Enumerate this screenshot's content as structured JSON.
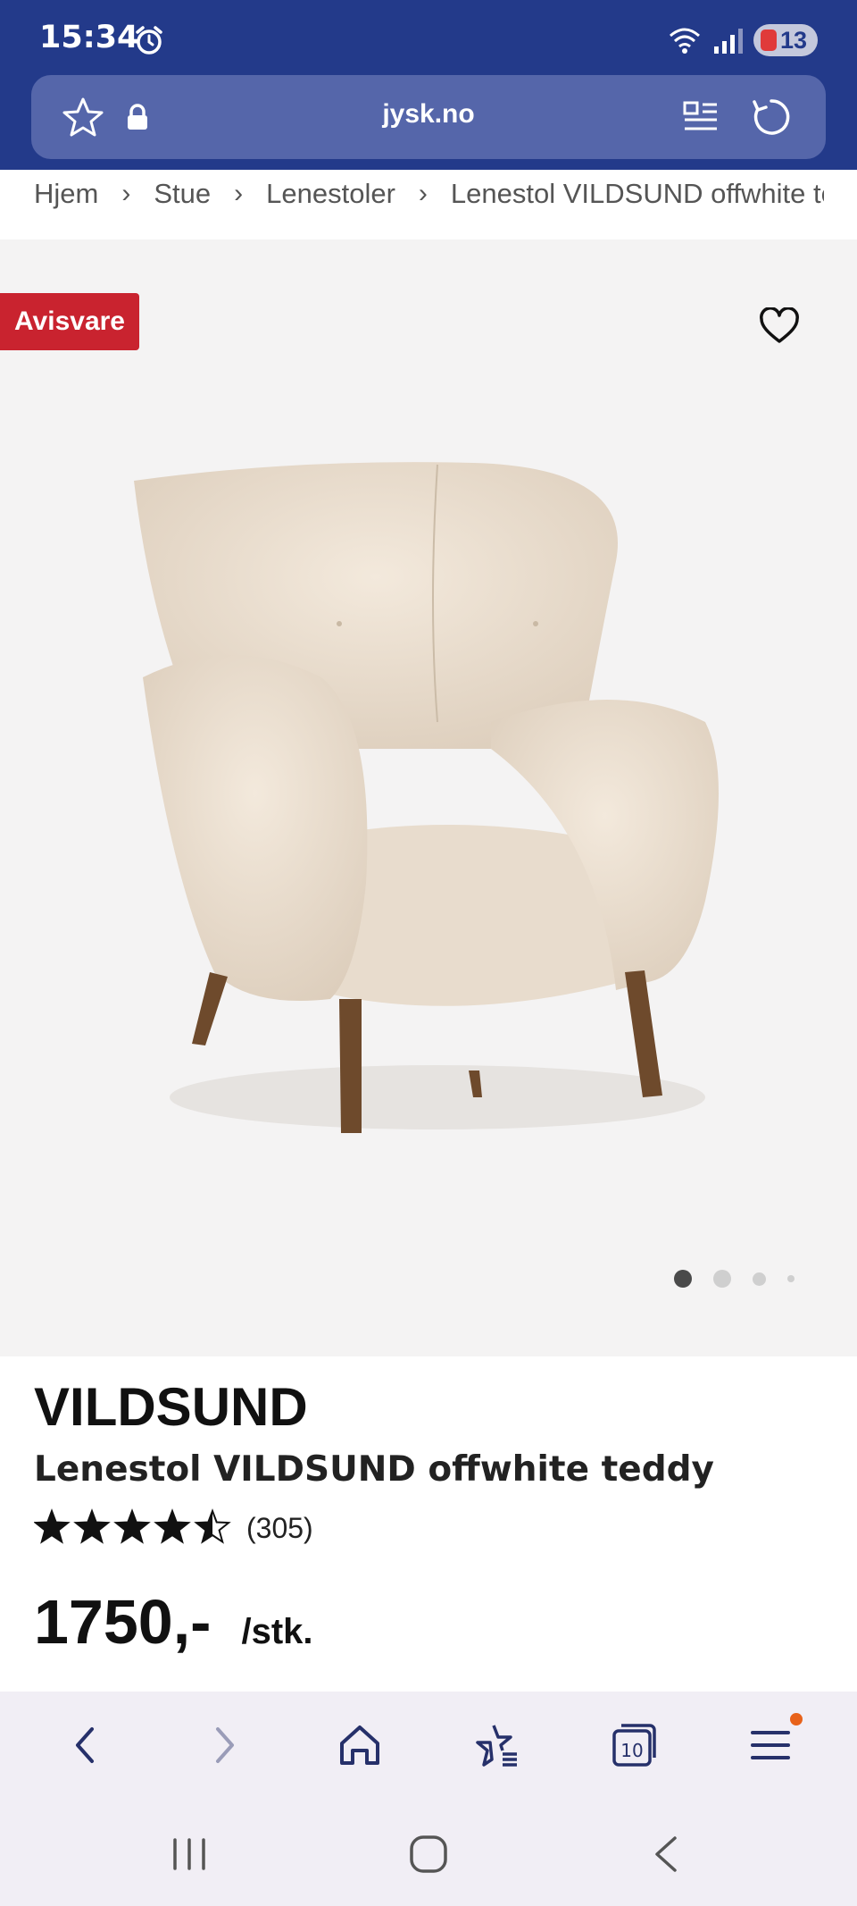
{
  "status_bar": {
    "time": "15:34",
    "battery": "13",
    "icons": [
      "alarm-icon",
      "wifi-icon",
      "signal-icon",
      "battery-icon"
    ]
  },
  "browser": {
    "url": "jysk.no",
    "icons": [
      "star-icon",
      "lock-icon",
      "reader-mode-icon",
      "reload-icon"
    ]
  },
  "breadcrumb": {
    "items": [
      "Hjem",
      "Stue",
      "Lenestoler",
      "Lenestol VILDSUND offwhite teddy"
    ],
    "separator": "›"
  },
  "product": {
    "badge": "Avisvare",
    "brand": "VILDSUND",
    "name": "Lenestol VILDSUND offwhite teddy",
    "rating": 4.5,
    "rating_max": 5,
    "review_count": "(305)",
    "price": "1750,-",
    "unit": "/stk.",
    "image_pages": 4,
    "active_image": 1
  },
  "toolbar": {
    "icons": [
      "back-icon",
      "forward-icon",
      "home-icon",
      "bookmarks-icon",
      "tabs-icon",
      "menu-icon"
    ],
    "tab_count": "10"
  },
  "colors": {
    "brand_blue": "#233a8a",
    "badge_red": "#c9232f",
    "image_bg": "#f4f3f3",
    "menu_notification": "#e8621a"
  }
}
